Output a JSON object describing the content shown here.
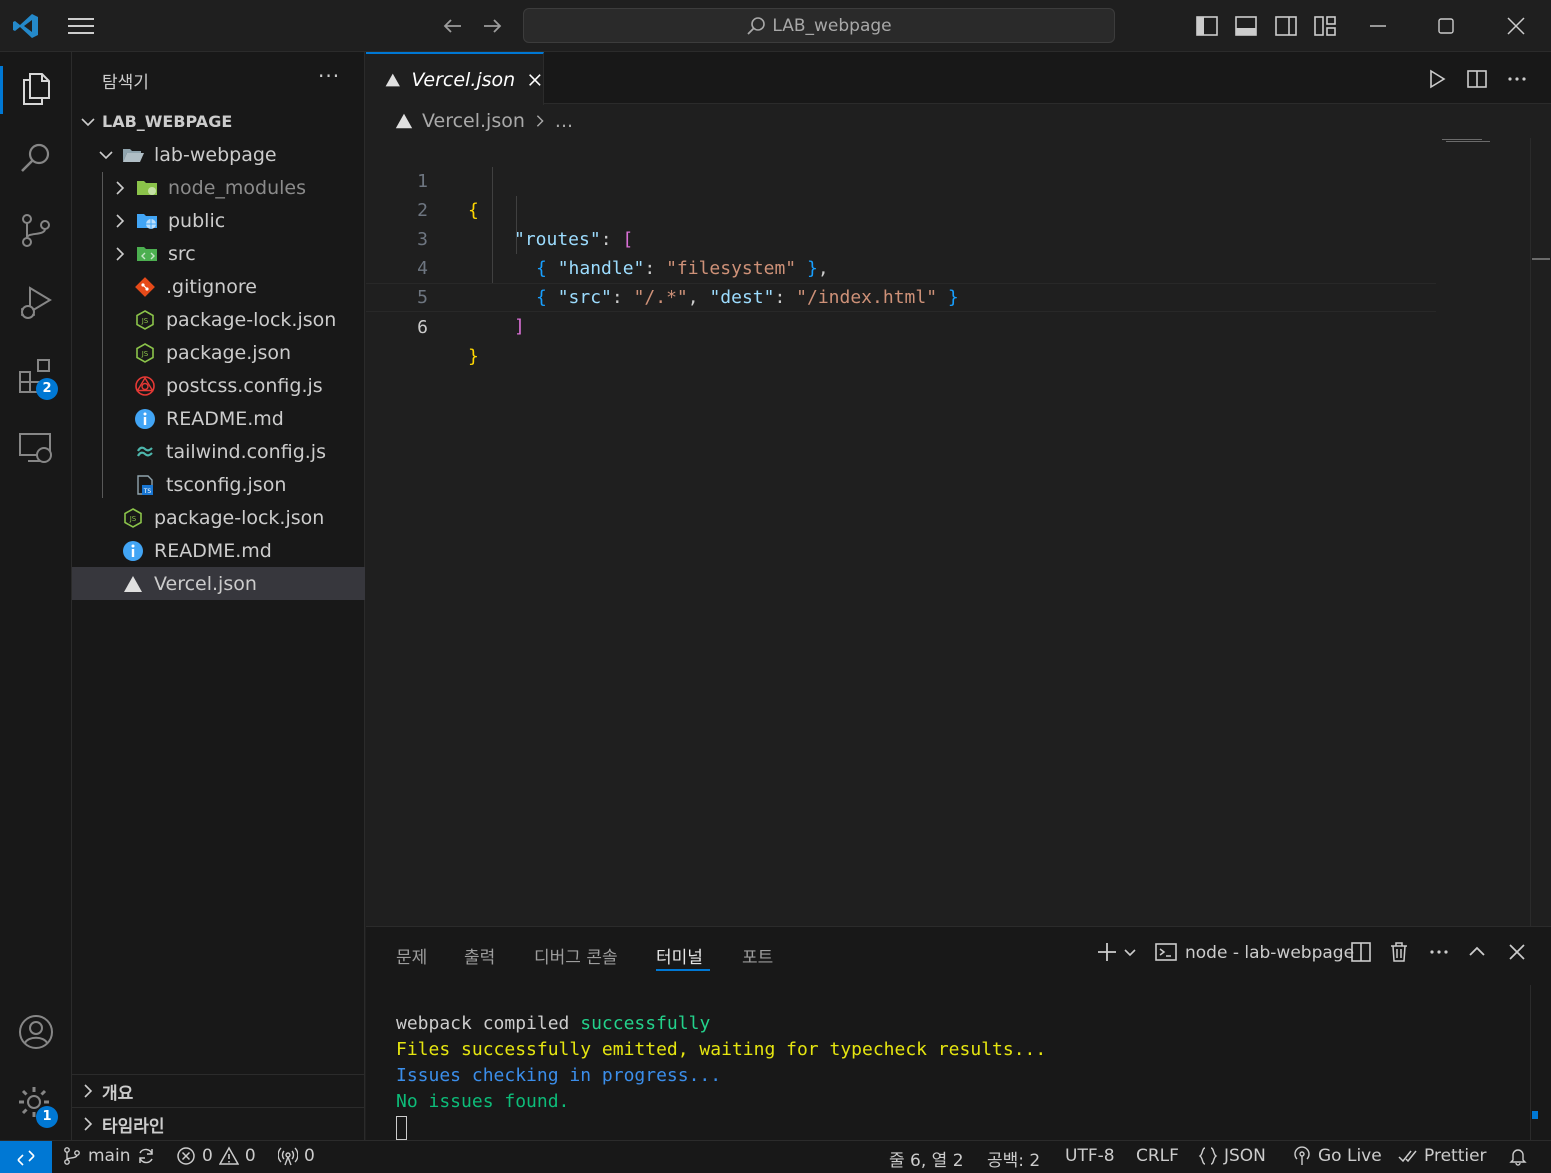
{
  "window": {
    "search_text": "LAB_webpage"
  },
  "activity": {
    "extensions_badge": "2",
    "settings_badge": "1"
  },
  "sidebar": {
    "title": "탐색기",
    "more": "···",
    "root": "LAB_WEBPAGE",
    "items": [
      {
        "label": "lab-webpage"
      },
      {
        "label": "node_modules"
      },
      {
        "label": "public"
      },
      {
        "label": "src"
      },
      {
        "label": ".gitignore"
      },
      {
        "label": "package-lock.json"
      },
      {
        "label": "package.json"
      },
      {
        "label": "postcss.config.js"
      },
      {
        "label": "README.md"
      },
      {
        "label": "tailwind.config.js"
      },
      {
        "label": "tsconfig.json"
      },
      {
        "label": "package-lock.json"
      },
      {
        "label": "README.md"
      },
      {
        "label": "Vercel.json"
      }
    ],
    "sections": [
      {
        "label": "개요"
      },
      {
        "label": "타임라인"
      }
    ]
  },
  "editor": {
    "tab_label": "Vercel.json",
    "breadcrumb_file": "Vercel.json",
    "breadcrumb_more": "...",
    "line_numbers": [
      "1",
      "2",
      "3",
      "4",
      "5",
      "6"
    ],
    "code": {
      "l1_open": "{",
      "l2_key": "\"routes\"",
      "l2_colon": ": ",
      "l2_bracket": "[",
      "l3_open": "{ ",
      "l3_key": "\"handle\"",
      "l3_colon": ": ",
      "l3_val": "\"filesystem\"",
      "l3_close": " }",
      "l3_comma": ",",
      "l4_open": "{ ",
      "l4_key1": "\"src\"",
      "l4_colon1": ": ",
      "l4_val1": "\"/.*\"",
      "l4_comma": ", ",
      "l4_key2": "\"dest\"",
      "l4_colon2": ": ",
      "l4_val2": "\"/index.html\"",
      "l4_close": " }",
      "l5_bracket": "]",
      "l6_close": "}"
    }
  },
  "panel": {
    "tabs": [
      {
        "label": "문제"
      },
      {
        "label": "출력"
      },
      {
        "label": "디버그 콘솔"
      },
      {
        "label": "터미널"
      },
      {
        "label": "포트"
      }
    ],
    "active_tab": "터미널",
    "terminal_name": "node - lab-webpage",
    "terminal": {
      "l1_a": "webpack compiled ",
      "l1_b": "successfully",
      "l2": "Files successfully emitted, waiting for typecheck results...",
      "l3": "Issues checking in progress...",
      "l4": "No issues found."
    }
  },
  "status": {
    "branch": "main",
    "errors": "0",
    "warnings": "0",
    "ports": "0",
    "position": "줄 6, 열 2",
    "spaces": "공백: 2",
    "encoding": "UTF-8",
    "eol": "CRLF",
    "language": "JSON",
    "golive": "Go Live",
    "prettier": "Prettier"
  }
}
